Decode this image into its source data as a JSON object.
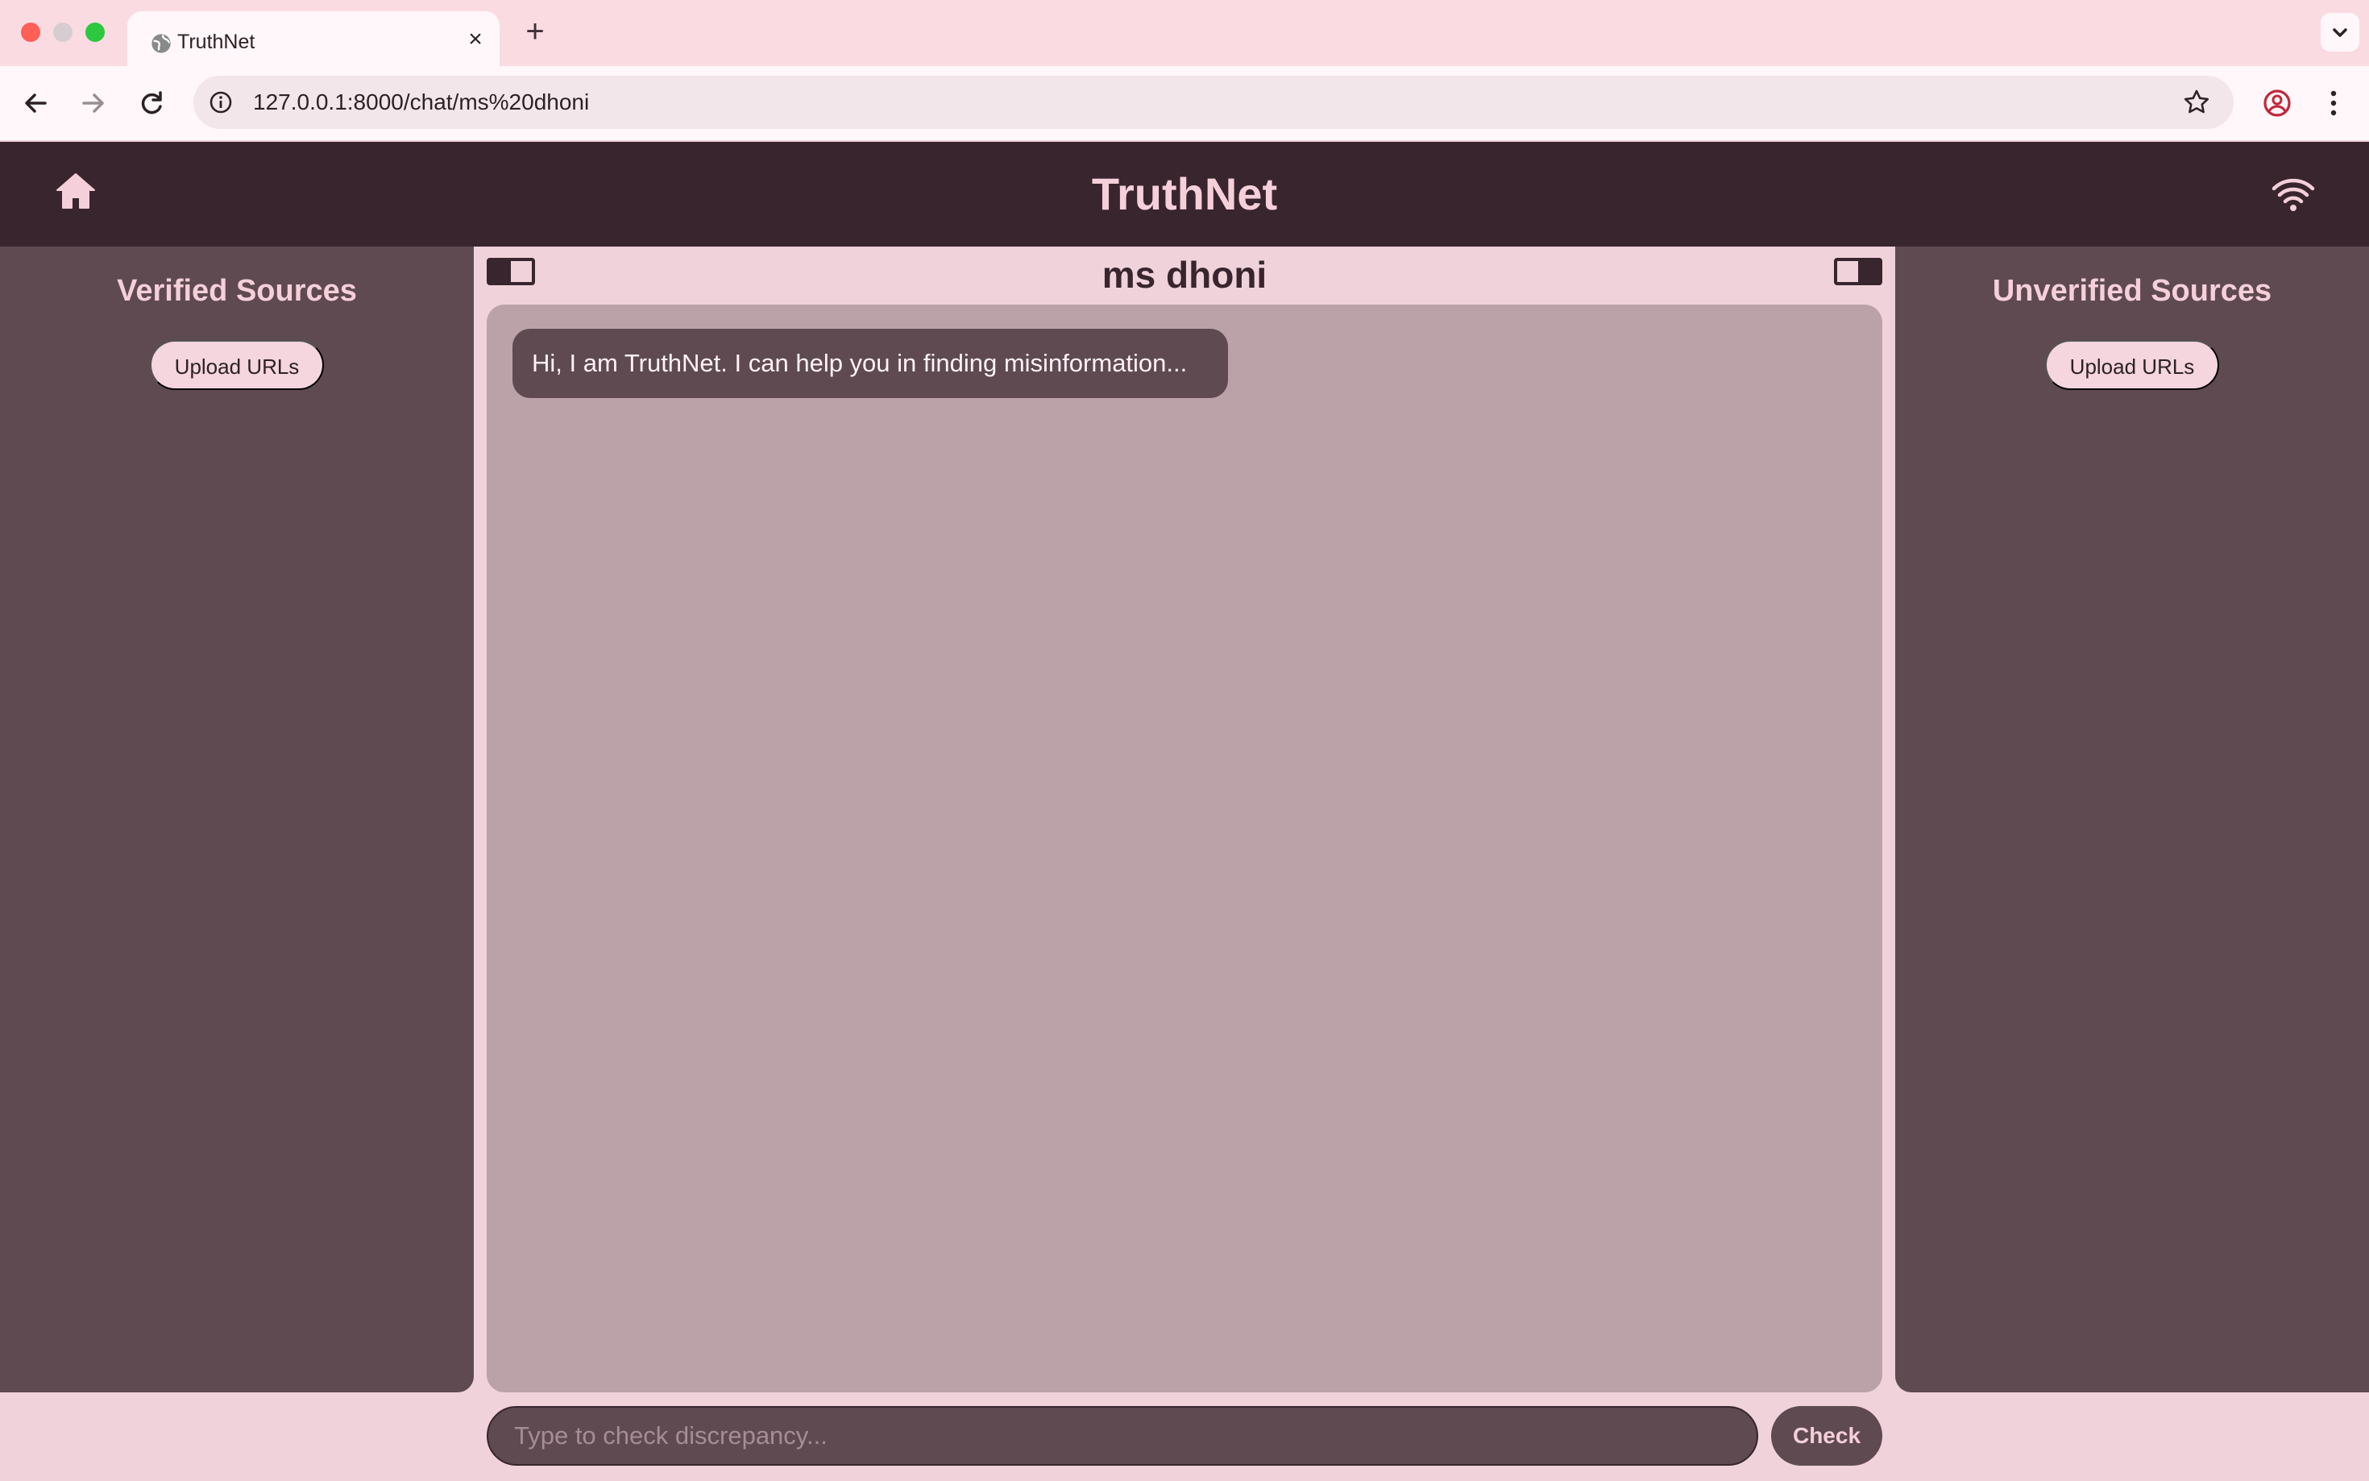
{
  "browser": {
    "tab_title": "TruthNet",
    "tab_favicon": "globe-icon",
    "address": "127.0.0.1:8000/chat/ms%20dhoni"
  },
  "header": {
    "title": "TruthNet",
    "home_icon": "home-icon",
    "status_icon": "wifi-icon"
  },
  "left_panel": {
    "title": "Verified Sources",
    "upload_label": "Upload URLs"
  },
  "right_panel": {
    "title": "Unverified Sources",
    "upload_label": "Upload URLs"
  },
  "chat": {
    "title": "ms dhoni",
    "messages": [
      {
        "sender": "bot",
        "text": "Hi, I am TruthNet. I can help you in finding misinformation..."
      }
    ]
  },
  "input": {
    "placeholder": "Type to check discrepancy...",
    "value": "",
    "submit_label": "Check"
  },
  "colors": {
    "header_bg": "#38252d",
    "panel_bg": "#5f4a52",
    "chat_bg": "#bba2a8",
    "page_bg": "#f0d2da",
    "accent_text": "#f5cfd9"
  }
}
